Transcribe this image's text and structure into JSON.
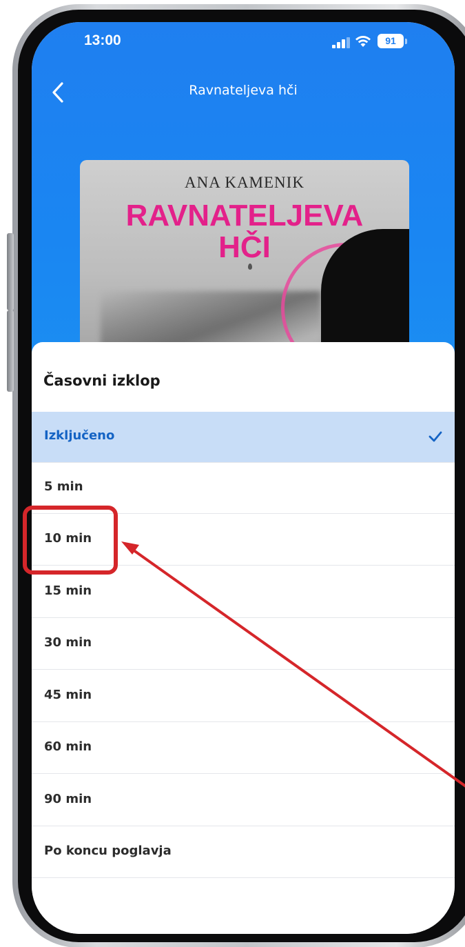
{
  "status_bar": {
    "time": "13:00",
    "battery": "91",
    "icons": [
      "signal-icon",
      "wifi-icon",
      "battery-icon"
    ]
  },
  "header": {
    "title": "Ravnateljeva hči",
    "back_icon": "chevron-left-icon"
  },
  "cover": {
    "author": "ANA KAMENIK",
    "title_line1": "RAVNATELJEVA",
    "title_line2": "HČI"
  },
  "sleep_timer": {
    "title": "Časovni izklop",
    "options": [
      {
        "label": "Izključeno",
        "selected": true
      },
      {
        "label": "5 min",
        "selected": false
      },
      {
        "label": "10 min",
        "selected": false
      },
      {
        "label": "15 min",
        "selected": false
      },
      {
        "label": "30 min",
        "selected": false
      },
      {
        "label": "45 min",
        "selected": false
      },
      {
        "label": "60 min",
        "selected": false
      },
      {
        "label": "90 min",
        "selected": false
      },
      {
        "label": "Po koncu poglavja",
        "selected": false
      }
    ],
    "check_icon": "checkmark-icon"
  },
  "annotation": {
    "highlighted_option": "10 min",
    "color": "#d5262a"
  },
  "colors": {
    "header_blue": "#1f7ff0",
    "selected_row": "#c8ddf7",
    "selected_text": "#1463c4",
    "cover_pink": "#e3218a"
  }
}
